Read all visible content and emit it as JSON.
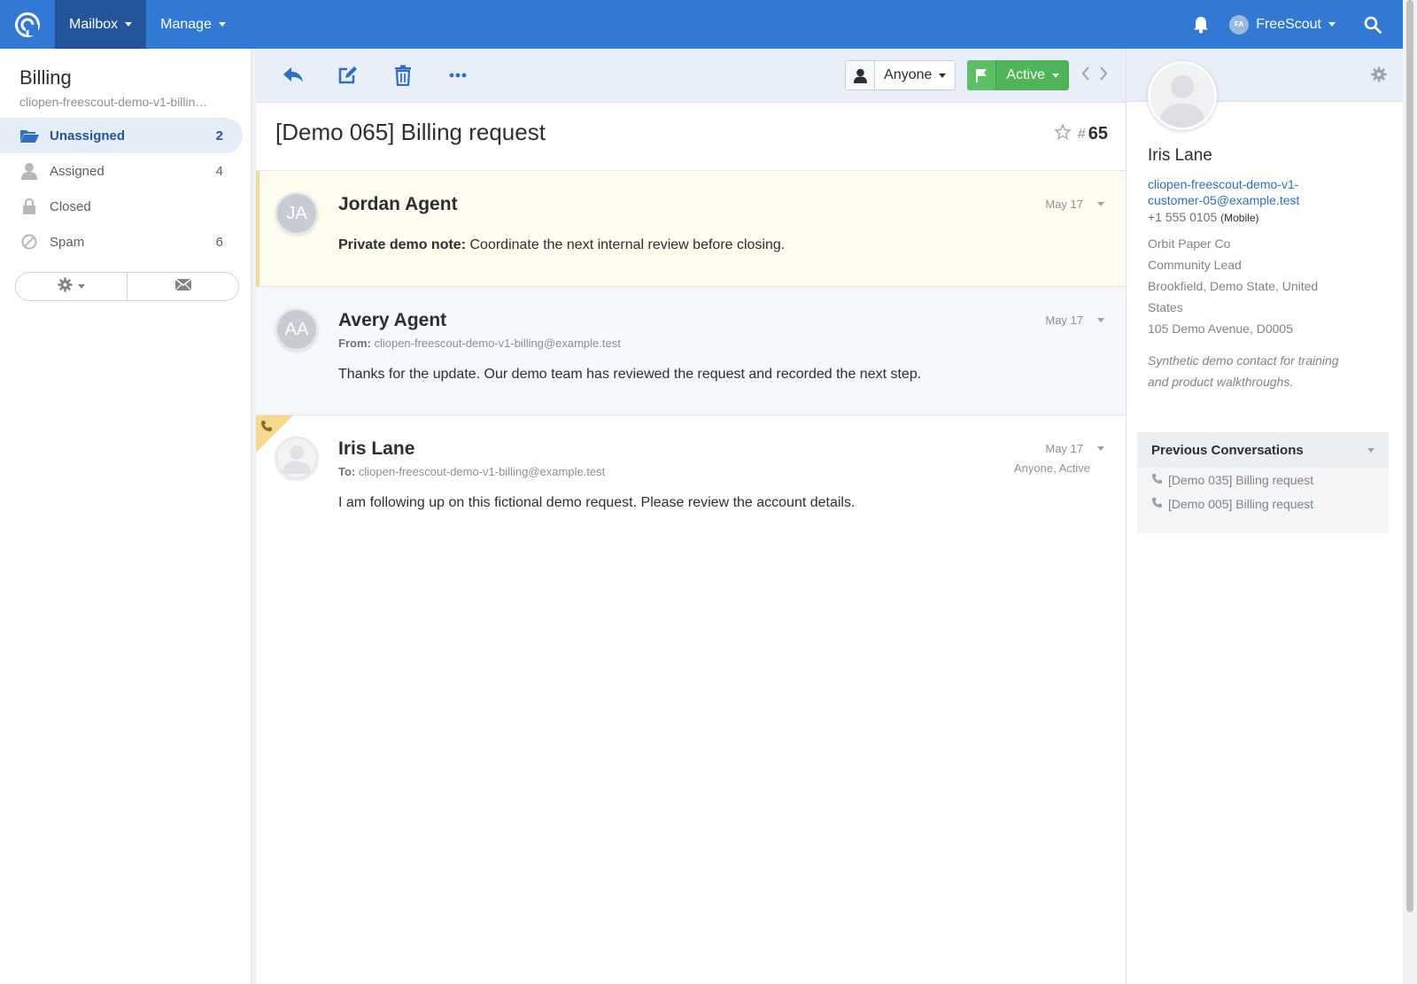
{
  "topbar": {
    "nav": [
      {
        "label": "Mailbox",
        "active": true
      },
      {
        "label": "Manage",
        "active": false
      }
    ],
    "user_initials": "FA",
    "user_name": "FreeScout"
  },
  "sidebar": {
    "title": "Billing",
    "subtitle": "cliopen-freescout-demo-v1-billin…",
    "folders": [
      {
        "label": "Unassigned",
        "count": "2",
        "icon": "folder-open-icon",
        "active": true
      },
      {
        "label": "Assigned",
        "count": "4",
        "icon": "user-icon",
        "active": false
      },
      {
        "label": "Closed",
        "count": "",
        "icon": "lock-icon",
        "active": false
      },
      {
        "label": "Spam",
        "count": "6",
        "icon": "ban-icon",
        "active": false
      }
    ]
  },
  "toolbar": {
    "assignee_label": "Anyone",
    "status_label": "Active"
  },
  "conversation": {
    "subject": "[Demo 065] Billing request",
    "hash": "#",
    "number": "65",
    "threads": [
      {
        "type": "note",
        "avatar": "JA",
        "name": "Jordan Agent",
        "date": "May 17",
        "body_label": "Private demo note:",
        "body": "Coordinate the next internal review before closing."
      },
      {
        "type": "reply",
        "avatar": "AA",
        "name": "Avery Agent",
        "date": "May 17",
        "meta_label": "From:",
        "meta_value": "cliopen-freescout-demo-v1-billing@example.test",
        "body": "Thanks for the update. Our demo team has reviewed the request and recorded the next step."
      },
      {
        "type": "customer",
        "name": "Iris Lane",
        "date": "May 17",
        "meta_label": "To:",
        "meta_value": "cliopen-freescout-demo-v1-billing@example.test",
        "status": "Anyone, Active",
        "body": "I am following up on this fictional demo request. Please review the account details."
      }
    ]
  },
  "profile": {
    "name": "Iris Lane",
    "email_line1": "cliopen-freescout-demo-v1-",
    "email_line2": "customer-05@example.test",
    "phone": "+1 555 0105",
    "phone_type": "(Mobile)",
    "company": "Orbit Paper Co",
    "job_title": "Community Lead",
    "location_line1": "Brookfield, Demo State, United",
    "location_line2": "States",
    "address": "105 Demo Avenue, D0005",
    "notes_line1": "Synthetic demo contact for training",
    "notes_line2": "and product walkthroughs.",
    "previous_title": "Previous Conversations",
    "previous": [
      {
        "label": "[Demo 035] Billing request"
      },
      {
        "label": "[Demo 005] Billing request"
      }
    ]
  },
  "colors": {
    "topbar": "#3179d4",
    "topbar_active": "#24559a",
    "status_green": "#4fb358",
    "note_background": "#fffbed",
    "link_blue": "#2d6fc4"
  }
}
